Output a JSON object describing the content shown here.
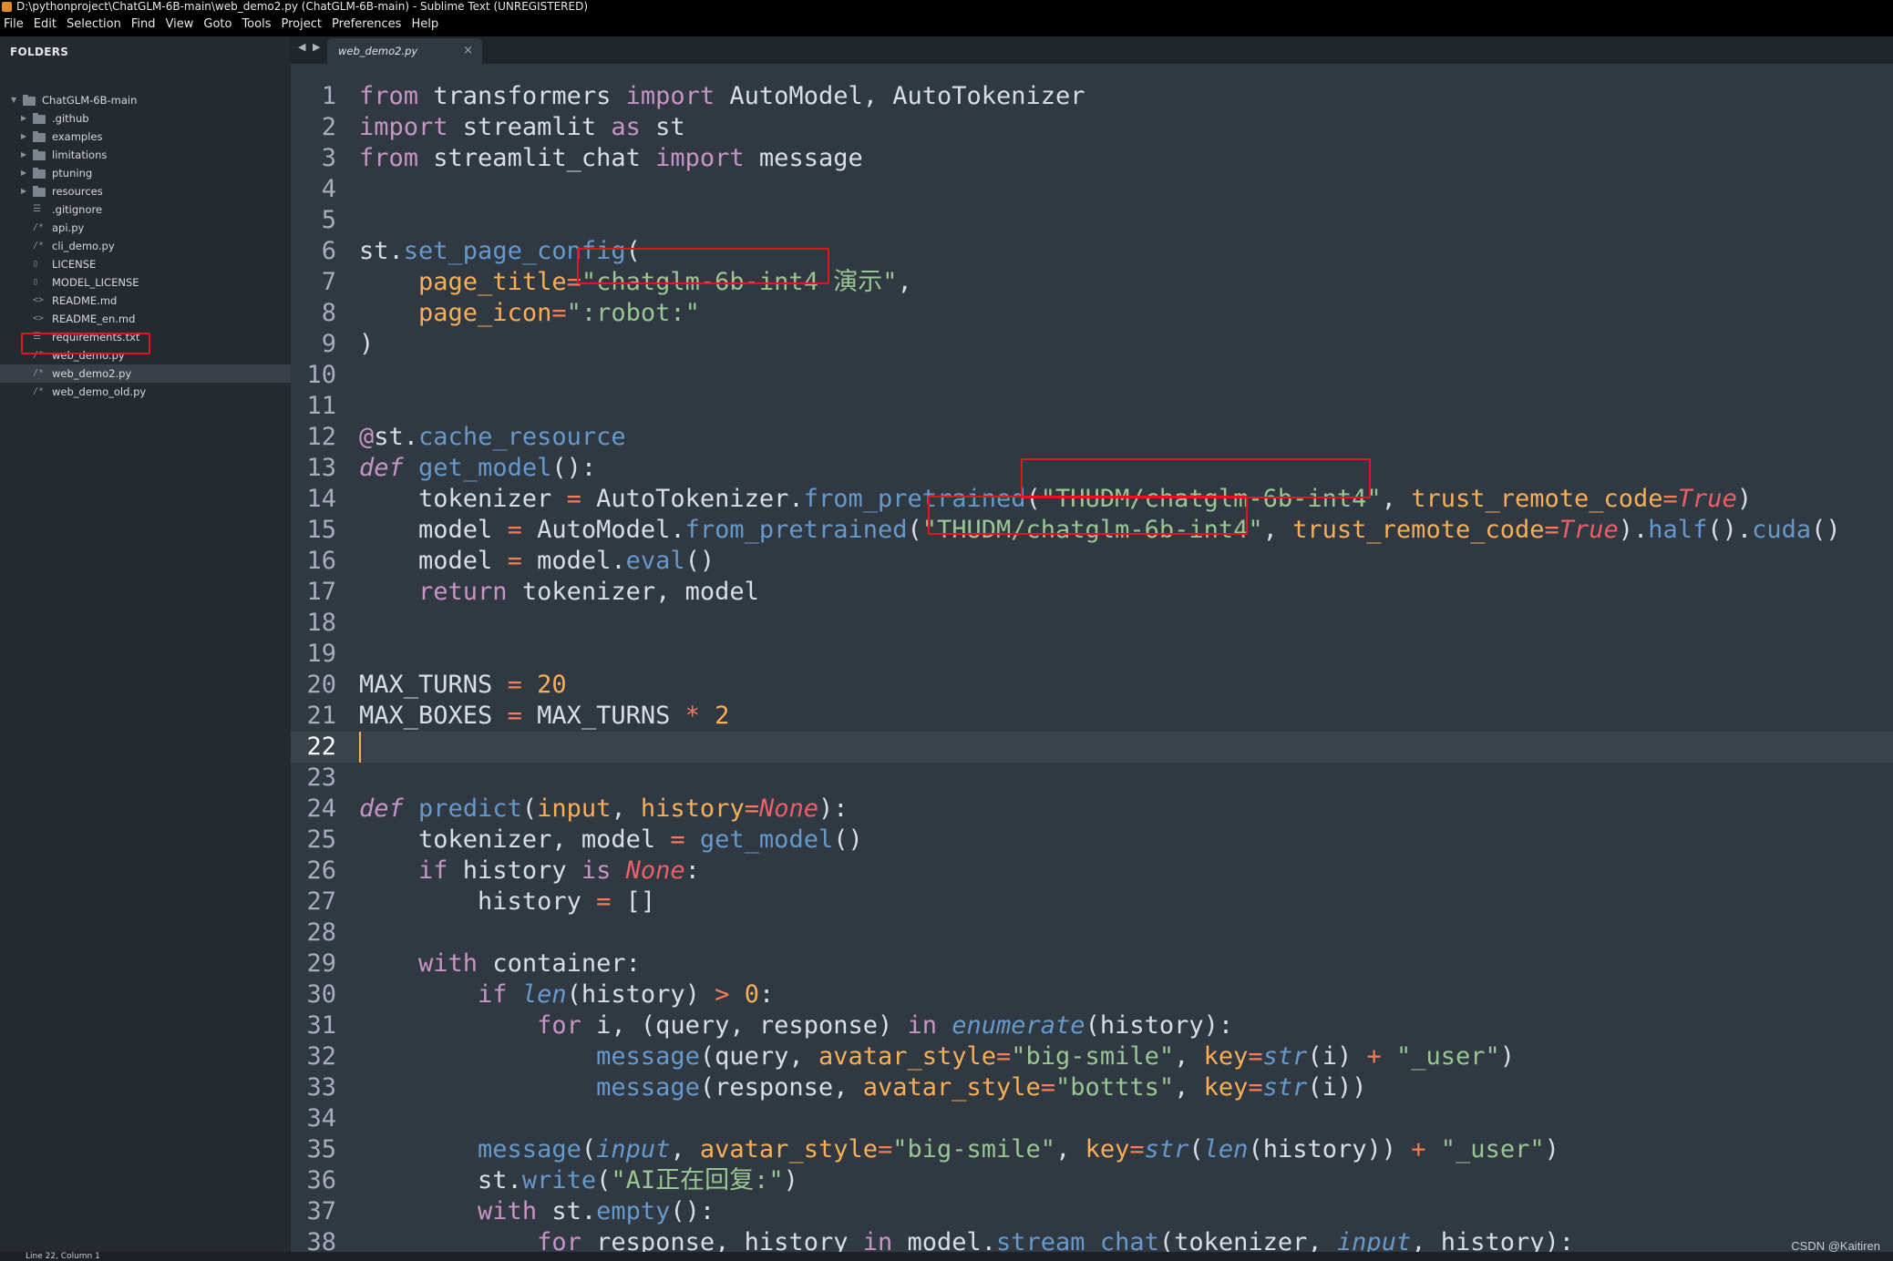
{
  "window": {
    "title": "D:\\pythonproject\\ChatGLM-6B-main\\web_demo2.py (ChatGLM-6B-main) - Sublime Text (UNREGISTERED)"
  },
  "menu": [
    "File",
    "Edit",
    "Selection",
    "Find",
    "View",
    "Goto",
    "Tools",
    "Project",
    "Preferences",
    "Help"
  ],
  "sidebar": {
    "heading": "FOLDERS",
    "root": "ChatGLM-6B-main",
    "items": [
      {
        "label": ".github",
        "kind": "folder"
      },
      {
        "label": "examples",
        "kind": "folder"
      },
      {
        "label": "limitations",
        "kind": "folder"
      },
      {
        "label": "ptuning",
        "kind": "folder"
      },
      {
        "label": "resources",
        "kind": "folder"
      },
      {
        "label": ".gitignore",
        "kind": "list"
      },
      {
        "label": "api.py",
        "kind": "py"
      },
      {
        "label": "cli_demo.py",
        "kind": "py"
      },
      {
        "label": "LICENSE",
        "kind": "file"
      },
      {
        "label": "MODEL_LICENSE",
        "kind": "file"
      },
      {
        "label": "README.md",
        "kind": "md"
      },
      {
        "label": "README_en.md",
        "kind": "md"
      },
      {
        "label": "requirements.txt",
        "kind": "list"
      },
      {
        "label": "web_demo.py",
        "kind": "py"
      },
      {
        "label": "web_demo2.py",
        "kind": "py",
        "active": true
      },
      {
        "label": "web_demo_old.py",
        "kind": "py"
      }
    ]
  },
  "tabs": [
    {
      "label": "web_demo2.py",
      "close": "×"
    }
  ],
  "nav_arrows": "◀ ▶",
  "editor": {
    "current_line": 22,
    "line_numbers": [
      "1",
      "2",
      "3",
      "4",
      "5",
      "6",
      "7",
      "8",
      "9",
      "10",
      "11",
      "12",
      "13",
      "14",
      "15",
      "16",
      "17",
      "18",
      "19",
      "20",
      "21",
      "22",
      "23",
      "24",
      "25",
      "26",
      "27",
      "28",
      "29",
      "30",
      "31",
      "32",
      "33",
      "34",
      "35",
      "36",
      "37",
      "38"
    ],
    "lines": [
      [
        [
          "from",
          "kw"
        ],
        [
          " transformers ",
          ""
        ],
        [
          "import",
          "kw"
        ],
        [
          " AutoModel, AutoTokenizer",
          ""
        ]
      ],
      [
        [
          "import",
          "kw"
        ],
        [
          " streamlit ",
          ""
        ],
        [
          "as",
          "kw"
        ],
        [
          " st",
          ""
        ]
      ],
      [
        [
          "from",
          "kw"
        ],
        [
          " streamlit_chat ",
          ""
        ],
        [
          "import",
          "kw"
        ],
        [
          " message",
          ""
        ]
      ],
      [],
      [],
      [
        [
          "st",
          ""
        ],
        [
          ".",
          ""
        ],
        [
          "set_page_config",
          "mth"
        ],
        [
          "(",
          ""
        ]
      ],
      [
        [
          "    ",
          ""
        ],
        [
          "page_title",
          "par"
        ],
        [
          "=",
          "op"
        ],
        [
          "\"chatglm-6b-int4 演示\"",
          "str"
        ],
        [
          ",",
          ""
        ]
      ],
      [
        [
          "    ",
          ""
        ],
        [
          "page_icon",
          "par"
        ],
        [
          "=",
          "op"
        ],
        [
          "\":robot:\"",
          "str"
        ]
      ],
      [
        [
          ")",
          ""
        ]
      ],
      [],
      [],
      [
        [
          "@",
          "dec"
        ],
        [
          "st",
          ""
        ],
        [
          ".",
          ""
        ],
        [
          "cache_resource",
          "mth"
        ]
      ],
      [
        [
          "def",
          "kw ital"
        ],
        [
          " ",
          ""
        ],
        [
          "get_model",
          "fn"
        ],
        [
          "():",
          ""
        ]
      ],
      [
        [
          "    tokenizer ",
          ""
        ],
        [
          "=",
          "op"
        ],
        [
          " AutoTokenizer.",
          ""
        ],
        [
          "from_pretrained",
          "mth"
        ],
        [
          "(",
          ""
        ],
        [
          "\"THUDM/chatglm-6b-int4\"",
          "str"
        ],
        [
          ", ",
          ""
        ],
        [
          "trust_remote_code",
          "par"
        ],
        [
          "=",
          "op"
        ],
        [
          "True",
          "cons"
        ],
        [
          ")",
          ""
        ]
      ],
      [
        [
          "    model ",
          ""
        ],
        [
          "=",
          "op"
        ],
        [
          " AutoModel.",
          ""
        ],
        [
          "from_pretrained",
          "mth"
        ],
        [
          "(",
          ""
        ],
        [
          "\"THUDM/chatglm-6b-int4\"",
          "str"
        ],
        [
          ", ",
          ""
        ],
        [
          "trust_remote_code",
          "par"
        ],
        [
          "=",
          "op"
        ],
        [
          "True",
          "cons"
        ],
        [
          ").",
          ""
        ],
        [
          "half",
          "mth"
        ],
        [
          "().",
          ""
        ],
        [
          "cuda",
          "mth"
        ],
        [
          "()",
          ""
        ]
      ],
      [
        [
          "    model ",
          ""
        ],
        [
          "=",
          "op"
        ],
        [
          " model.",
          ""
        ],
        [
          "eval",
          "mth"
        ],
        [
          "()",
          ""
        ]
      ],
      [
        [
          "    ",
          ""
        ],
        [
          "return",
          "kw"
        ],
        [
          " tokenizer, model",
          ""
        ]
      ],
      [],
      [],
      [
        [
          "MAX_TURNS ",
          ""
        ],
        [
          "=",
          "op"
        ],
        [
          " ",
          ""
        ],
        [
          "20",
          "num"
        ]
      ],
      [
        [
          "MAX_BOXES ",
          ""
        ],
        [
          "=",
          "op"
        ],
        [
          " MAX_TURNS ",
          ""
        ],
        [
          "*",
          "op"
        ],
        [
          " ",
          ""
        ],
        [
          "2",
          "num"
        ]
      ],
      [],
      [],
      [
        [
          "def",
          "kw ital"
        ],
        [
          " ",
          ""
        ],
        [
          "predict",
          "fn"
        ],
        [
          "(",
          ""
        ],
        [
          "input",
          "par"
        ],
        [
          ", ",
          ""
        ],
        [
          "history",
          "par"
        ],
        [
          "=",
          "op"
        ],
        [
          "None",
          "cons"
        ],
        [
          "):",
          ""
        ]
      ],
      [
        [
          "    tokenizer, model ",
          ""
        ],
        [
          "=",
          "op"
        ],
        [
          " ",
          ""
        ],
        [
          "get_model",
          "fn"
        ],
        [
          "()",
          ""
        ]
      ],
      [
        [
          "    ",
          ""
        ],
        [
          "if",
          "kw"
        ],
        [
          " history ",
          ""
        ],
        [
          "is",
          "kw"
        ],
        [
          " ",
          ""
        ],
        [
          "None",
          "cons"
        ],
        [
          ":",
          ""
        ]
      ],
      [
        [
          "        history ",
          ""
        ],
        [
          "=",
          "op"
        ],
        [
          " []",
          ""
        ]
      ],
      [],
      [
        [
          "    ",
          ""
        ],
        [
          "with",
          "kw"
        ],
        [
          " container:",
          ""
        ]
      ],
      [
        [
          "        ",
          ""
        ],
        [
          "if",
          "kw"
        ],
        [
          " ",
          ""
        ],
        [
          "len",
          "bi"
        ],
        [
          "(history) ",
          ""
        ],
        [
          ">",
          "op"
        ],
        [
          " ",
          ""
        ],
        [
          "0",
          "num"
        ],
        [
          ":",
          ""
        ]
      ],
      [
        [
          "            ",
          ""
        ],
        [
          "for",
          "kw"
        ],
        [
          " i, (query, response) ",
          ""
        ],
        [
          "in",
          "kw"
        ],
        [
          " ",
          ""
        ],
        [
          "enumerate",
          "bi"
        ],
        [
          "(history):",
          ""
        ]
      ],
      [
        [
          "                ",
          ""
        ],
        [
          "message",
          "fn"
        ],
        [
          "(query, ",
          ""
        ],
        [
          "avatar_style",
          "par"
        ],
        [
          "=",
          "op"
        ],
        [
          "\"big-smile\"",
          "str"
        ],
        [
          ", ",
          ""
        ],
        [
          "key",
          "par"
        ],
        [
          "=",
          "op"
        ],
        [
          "str",
          "bi"
        ],
        [
          "(i) ",
          ""
        ],
        [
          "+",
          "op"
        ],
        [
          " ",
          ""
        ],
        [
          "\"_user\"",
          "str"
        ],
        [
          ")",
          ""
        ]
      ],
      [
        [
          "                ",
          ""
        ],
        [
          "message",
          "fn"
        ],
        [
          "(response, ",
          ""
        ],
        [
          "avatar_style",
          "par"
        ],
        [
          "=",
          "op"
        ],
        [
          "\"bottts\"",
          "str"
        ],
        [
          ", ",
          ""
        ],
        [
          "key",
          "par"
        ],
        [
          "=",
          "op"
        ],
        [
          "str",
          "bi"
        ],
        [
          "(i))",
          ""
        ]
      ],
      [],
      [
        [
          "        ",
          ""
        ],
        [
          "message",
          "fn"
        ],
        [
          "(",
          ""
        ],
        [
          "input",
          "bi"
        ],
        [
          ", ",
          ""
        ],
        [
          "avatar_style",
          "par"
        ],
        [
          "=",
          "op"
        ],
        [
          "\"big-smile\"",
          "str"
        ],
        [
          ", ",
          ""
        ],
        [
          "key",
          "par"
        ],
        [
          "=",
          "op"
        ],
        [
          "str",
          "bi"
        ],
        [
          "(",
          ""
        ],
        [
          "len",
          "bi"
        ],
        [
          "(history)) ",
          ""
        ],
        [
          "+",
          "op"
        ],
        [
          " ",
          ""
        ],
        [
          "\"_user\"",
          "str"
        ],
        [
          ")",
          ""
        ]
      ],
      [
        [
          "        st.",
          ""
        ],
        [
          "write",
          "mth"
        ],
        [
          "(",
          ""
        ],
        [
          "\"AI正在回复:\"",
          "str"
        ],
        [
          ")",
          ""
        ]
      ],
      [
        [
          "        ",
          ""
        ],
        [
          "with",
          "kw"
        ],
        [
          " st.",
          ""
        ],
        [
          "empty",
          "mth"
        ],
        [
          "():",
          ""
        ]
      ],
      [
        [
          "            ",
          ""
        ],
        [
          "for",
          "kw"
        ],
        [
          " response, history ",
          ""
        ],
        [
          "in",
          "kw"
        ],
        [
          " model.",
          ""
        ],
        [
          "stream_chat",
          "mth"
        ],
        [
          "(tokenizer, ",
          ""
        ],
        [
          "input",
          "bi"
        ],
        [
          ", history):",
          ""
        ]
      ]
    ]
  },
  "status": {
    "text": "Line 22, Column 1"
  },
  "watermark": "CSDN @Kaitiren",
  "colors": {
    "highlight_box": "#e5141e",
    "editor_bg": "#303841",
    "sidebar_bg": "#252a31"
  }
}
